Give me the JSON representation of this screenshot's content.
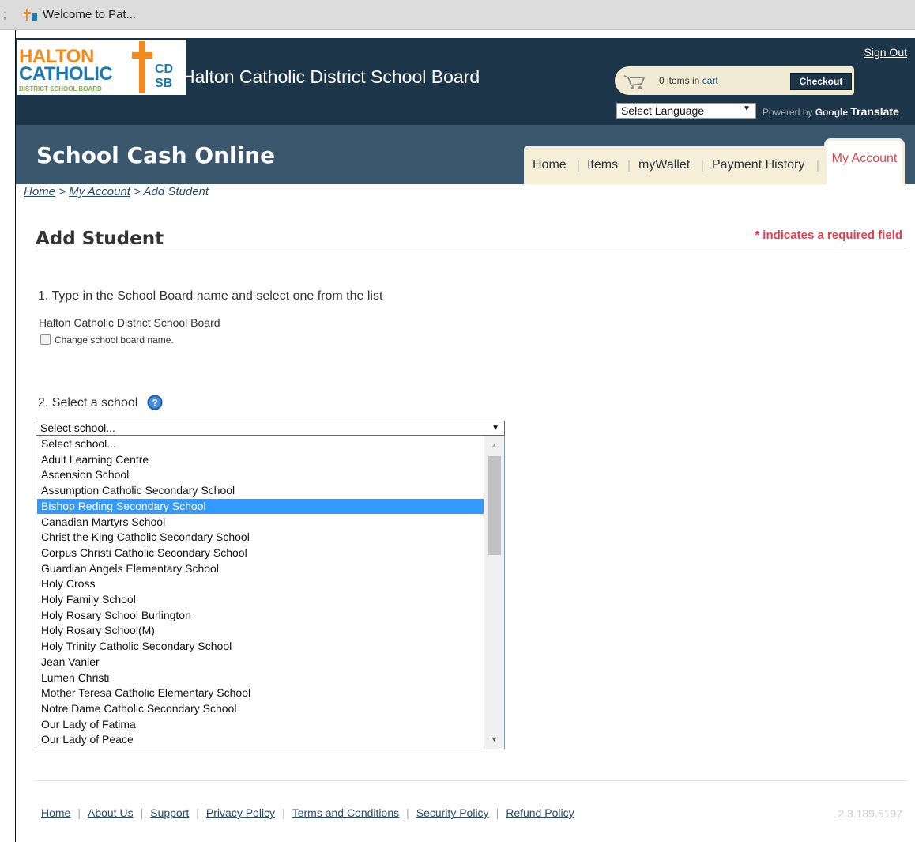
{
  "browser": {
    "tab_edge": ";",
    "tab_title": "Welcome to Pat..."
  },
  "header": {
    "logo": {
      "line1": "HALTON",
      "line2": "CATHOLIC",
      "line3": "DISTRICT SCHOOL BOARD",
      "cds_top": "CD",
      "cds_bottom": "SB"
    },
    "board_title": "Halton Catholic District School Board",
    "sign_out": "Sign Out",
    "cart": {
      "count_text": "0 items in",
      "cart_link": "cart",
      "checkout": "Checkout"
    },
    "language_select": "Select Language",
    "powered_by": "Powered by",
    "google": "Google",
    "translate": "Translate"
  },
  "nav": {
    "site_title": "School Cash Online",
    "tabs": [
      "Home",
      "Items",
      "myWallet",
      "Payment History"
    ],
    "active_tab": "My Account"
  },
  "breadcrumb": {
    "home": "Home",
    "sep1": ">",
    "my_account": "My Account",
    "sep2": ">",
    "current": "Add Student"
  },
  "page": {
    "title": "Add Student",
    "required_note": "* indicates a required field",
    "step1_label": "1. Type in the School Board name and select one from the list",
    "board_name": "Halton Catholic District School Board",
    "change_board_label": "Change school board name.",
    "step2_label": "2. Select a school",
    "school_select_value": "Select school...",
    "school_options": [
      "Select school...",
      "Adult Learning Centre",
      "Ascension School",
      "Assumption Catholic Secondary School",
      "Bishop Reding Secondary School",
      "Canadian Martyrs School",
      "Christ the King Catholic Secondary School",
      "Corpus Christi Catholic Secondary School",
      "Guardian Angels Elementary School",
      "Holy Cross",
      "Holy Family School",
      "Holy Rosary School Burlington",
      "Holy Rosary School(M)",
      "Holy Trinity Catholic Secondary School",
      "Jean Vanier",
      "Lumen Christi",
      "Mother Teresa Catholic Elementary School",
      "Notre Dame Catholic Secondary School",
      "Our Lady of Fatima",
      "Our Lady of Peace"
    ],
    "highlighted_option": "Bishop Reding Secondary School"
  },
  "footer": {
    "links": [
      "Home",
      "About Us",
      "Support",
      "Privacy Policy",
      "Terms and Conditions",
      "Security Policy",
      "Refund Policy"
    ],
    "version": "2.3.189.5197"
  },
  "colors": {
    "header_bg": "#1c3549",
    "nav_bg": "#3b576e",
    "tab_bg": "#f5efd9",
    "active_tab_text": "#e04848",
    "required_text": "#ee3b4c",
    "selection": "#3399ff"
  }
}
